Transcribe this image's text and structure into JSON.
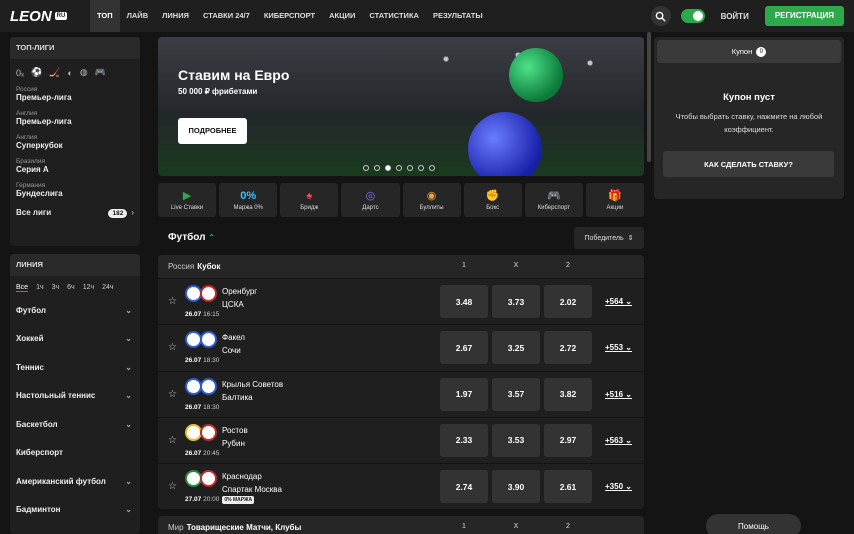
{
  "header": {
    "logo": "LEON",
    "logo_badge": "RU",
    "nav": [
      "ТОП",
      "ЛАЙВ",
      "ЛИНИЯ",
      "СТАВКИ 24/7",
      "КИБЕРСПОРТ",
      "АКЦИИ",
      "СТАТИСТИКА",
      "РЕЗУЛЬТАТЫ"
    ],
    "login": "ВОЙТИ",
    "register": "РЕГИСТРАЦИЯ"
  },
  "top_leagues": {
    "title": "ТОП-ЛИГИ",
    "items": [
      {
        "country": "Россия",
        "name": "Премьер-лига"
      },
      {
        "country": "Англия",
        "name": "Премьер-лига"
      },
      {
        "country": "Англия",
        "name": "Суперкубок"
      },
      {
        "country": "Бразилия",
        "name": "Серия А"
      },
      {
        "country": "Германия",
        "name": "Бундеслига"
      }
    ],
    "all_label": "Все лиги",
    "all_count": "182"
  },
  "line": {
    "title": "ЛИНИЯ",
    "filters": [
      "Все",
      "1ч",
      "3ч",
      "6ч",
      "12ч",
      "24ч"
    ],
    "sports": [
      "Футбол",
      "Хоккей",
      "Теннис",
      "Настольный теннис",
      "Баскетбол",
      "Киберспорт",
      "Американский футбол",
      "Бадминтон"
    ]
  },
  "banner": {
    "title": "Ставим на Евро",
    "subtitle": "50 000 ₽ фрибетами",
    "button": "ПОДРОБНЕЕ"
  },
  "tiles": [
    {
      "label": "Live Ставки",
      "icon": "▶"
    },
    {
      "label": "Маржа 0%",
      "icon": "0%"
    },
    {
      "label": "Бридж",
      "icon": "♠"
    },
    {
      "label": "Дартс",
      "icon": "◎"
    },
    {
      "label": "Буллиты",
      "icon": "◉"
    },
    {
      "label": "Бокс",
      "icon": "✊"
    },
    {
      "label": "Киберспорт",
      "icon": "🎮"
    },
    {
      "label": "Акции",
      "icon": "🎁"
    }
  ],
  "section": {
    "sport": "Футбол",
    "market": "Победитель"
  },
  "league_block": {
    "country": "Россия",
    "league": "Кубок",
    "cols": [
      "1",
      "X",
      "2"
    ]
  },
  "events": [
    {
      "home": "Оренбург",
      "away": "ЦСКА",
      "date": "26.07",
      "time": "16:15",
      "o1": "3.48",
      "ox": "3.73",
      "o2": "2.02",
      "more": "+564"
    },
    {
      "home": "Факел",
      "away": "Сочи",
      "date": "26.07",
      "time": "18:30",
      "o1": "2.67",
      "ox": "3.25",
      "o2": "2.72",
      "more": "+553"
    },
    {
      "home": "Крылья Советов",
      "away": "Балтика",
      "date": "26.07",
      "time": "18:30",
      "o1": "1.97",
      "ox": "3.57",
      "o2": "3.82",
      "more": "+516"
    },
    {
      "home": "Ростов",
      "away": "Рубин",
      "date": "26.07",
      "time": "20:45",
      "o1": "2.33",
      "ox": "3.53",
      "o2": "2.97",
      "more": "+563"
    },
    {
      "home": "Краснодар",
      "away": "Спартак Москва",
      "date": "27.07",
      "time": "20:00",
      "o1": "2.74",
      "ox": "3.90",
      "o2": "2.61",
      "more": "+350",
      "badge": "0% МАРЖА"
    }
  ],
  "league_block2": {
    "country": "Мир",
    "league": "Товарищеские Матчи, Клубы",
    "cols": [
      "1",
      "X",
      "2"
    ]
  },
  "coupon": {
    "tab": "Купон",
    "count": "0",
    "title": "Купон пуст",
    "text": "Чтобы выбрать ставку, нажмите на любой коэффициент.",
    "how": "КАК СДЕЛАТЬ СТАВКУ?"
  },
  "help": "Помощь",
  "colors": {
    "accent": "#2da84a",
    "bg": "#141414",
    "panel": "#1f1f1f"
  }
}
